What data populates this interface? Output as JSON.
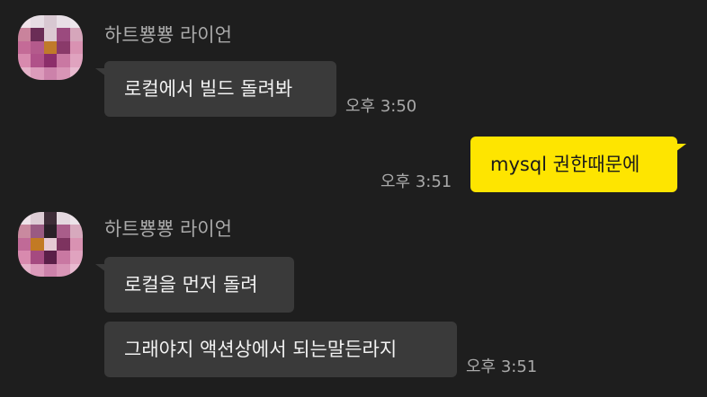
{
  "chat": {
    "groups": [
      {
        "sender": "하트뿅뿅 라이언",
        "messages": [
          {
            "text": "로컬에서 빌드 돌려봐",
            "time": "오후 3:50"
          }
        ]
      },
      {
        "mine": true,
        "messages": [
          {
            "text": "mysql 권한때문에",
            "time": "오후 3:51"
          }
        ]
      },
      {
        "sender": "하트뿅뿅 라이언",
        "messages": [
          {
            "text": "로컬을 먼저 돌려"
          },
          {
            "text": "그래야지 액션상에서 되는말든라지",
            "time": "오후 3:51"
          }
        ]
      }
    ]
  },
  "colors": {
    "background": "#1e1e1e",
    "other_bubble": "#3a3a3a",
    "my_bubble": "#fee500",
    "meta_text": "#a9a9a9"
  },
  "icons": {
    "avatar": "pixelated-profile-avatar"
  }
}
